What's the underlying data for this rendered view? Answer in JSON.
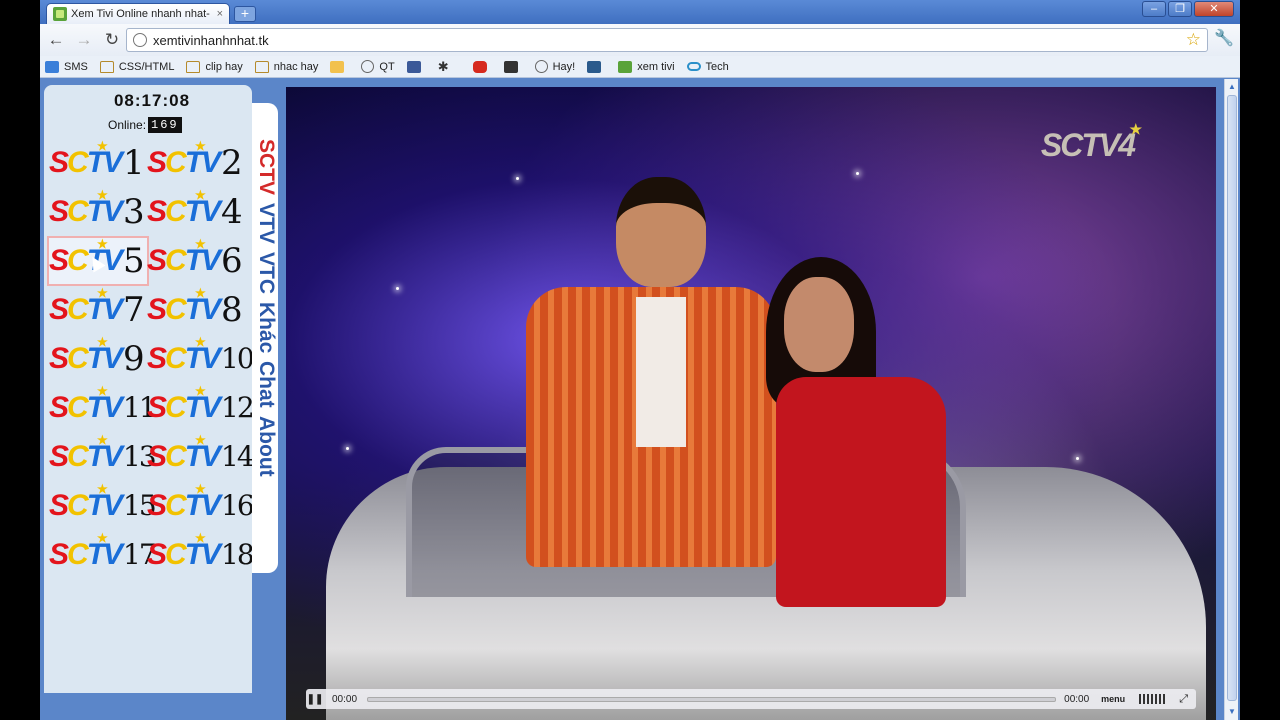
{
  "browser": {
    "tab_title": "Xem Tivi Online nhanh nhat- h",
    "tab_close": "×",
    "new_tab": "+",
    "window_controls": [
      "–",
      "❐",
      "✕"
    ],
    "back": "←",
    "forward": "→",
    "reload": "↻",
    "url": "xemtivinhanhnhat.tk",
    "bookmark_star": "☆",
    "wrench": "🔧"
  },
  "bookmarks": [
    {
      "label": "SMS",
      "icon": "sms-icon"
    },
    {
      "label": "CSS/HTML",
      "icon": "folder-icon"
    },
    {
      "label": "clip hay",
      "icon": "folder-icon"
    },
    {
      "label": "nhac hay",
      "icon": "folder-icon"
    },
    {
      "label": "",
      "icon": "mail-icon"
    },
    {
      "label": "QT",
      "icon": "globe-icon"
    },
    {
      "label": "",
      "icon": "facebook-icon"
    },
    {
      "label": "",
      "icon": "asterisk-icon"
    },
    {
      "label": "",
      "icon": "youtube-icon"
    },
    {
      "label": "",
      "icon": "film-icon"
    },
    {
      "label": "Hay!",
      "icon": "globe-icon"
    },
    {
      "label": "",
      "icon": "v-icon"
    },
    {
      "label": "xem tivi",
      "icon": "tv-icon"
    },
    {
      "label": "Tech",
      "icon": "link-icon"
    }
  ],
  "sidebar": {
    "clock": "08:17:08",
    "online_label": "Online:",
    "online_count": "169",
    "channel_brand": {
      "s": "S",
      "c": "C",
      "tv": "TV",
      "star": "★"
    },
    "channels": [
      "1",
      "2",
      "3",
      "4",
      "5",
      "6",
      "7",
      "8",
      "9",
      "10",
      "11",
      "12",
      "13",
      "14",
      "15",
      "16",
      "17",
      "18"
    ],
    "tabs": [
      "SCTV",
      "VTV",
      "VTC",
      "Khác",
      "Chat",
      "About"
    ],
    "active_tab": "SCTV"
  },
  "player": {
    "watermark": "SCTV4",
    "current_time": "00:00",
    "duration": "00:00",
    "menu_label": "menu",
    "pause_icon": "❚❚",
    "fullscreen_icon": "⤢",
    "progress": 0.0
  },
  "colors": {
    "page_bg": "#5b86c9",
    "sidebar_bg": "#dbe7f2",
    "logo_red": "#e3141c",
    "logo_yellow": "#f2c200",
    "logo_blue": "#1a6ed8",
    "tab_text": "#2b58a8"
  }
}
